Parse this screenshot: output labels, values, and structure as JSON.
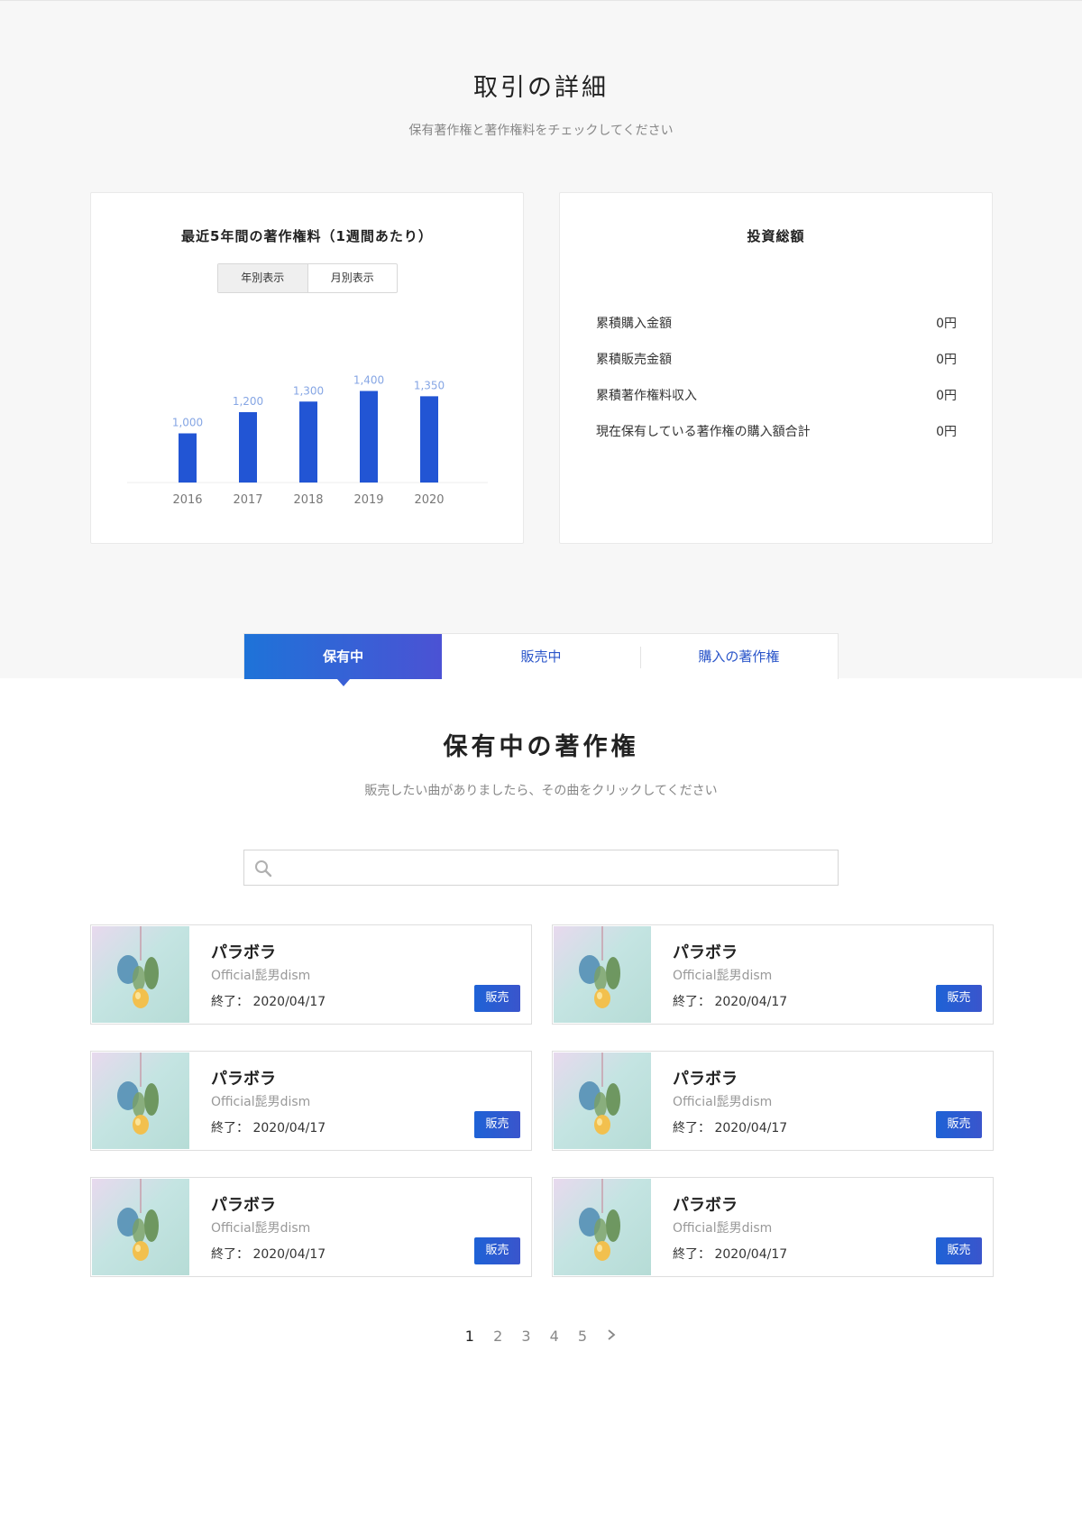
{
  "header": {
    "title": "取引の詳細",
    "subtitle": "保有著作権と著作権料をチェックしてください"
  },
  "chart_card": {
    "title": "最近5年間の著作権料（1週間あたり）",
    "toggle": {
      "yearly": "年別表示",
      "monthly": "月別表示",
      "selected": "yearly"
    }
  },
  "chart_data": {
    "type": "bar",
    "categories": [
      "2016",
      "2017",
      "2018",
      "2019",
      "2020"
    ],
    "values": [
      1000,
      1200,
      1300,
      1400,
      1350
    ],
    "value_labels": [
      "1,000",
      "1,200",
      "1,300",
      "1,400",
      "1,350"
    ],
    "title": "",
    "xlabel": "",
    "ylabel": "",
    "bar_color": "#2255d4",
    "label_color": "#86a6e4",
    "grid": false
  },
  "invest_card": {
    "title": "投資総額",
    "rows": [
      {
        "label": "累積購入金額",
        "value": "0円"
      },
      {
        "label": "累積販売金額",
        "value": "0円"
      },
      {
        "label": "累積著作権料収入",
        "value": "0円"
      },
      {
        "label": "現在保有している著作権の購入額合計",
        "value": "0円"
      }
    ]
  },
  "tabs": [
    {
      "label": "保有中",
      "active": true
    },
    {
      "label": "販売中",
      "active": false
    },
    {
      "label": "購入の著作権",
      "active": false
    }
  ],
  "owned": {
    "title": "保有中の著作権",
    "subtitle": "販売したい曲がありましたら、その曲をクリックしてください"
  },
  "search": {
    "placeholder": "",
    "value": ""
  },
  "items": [
    {
      "title": "パラボラ",
      "artist": "Official髭男dism",
      "end": "終了： 2020/04/17",
      "button": "販売"
    },
    {
      "title": "パラボラ",
      "artist": "Official髭男dism",
      "end": "終了： 2020/04/17",
      "button": "販売"
    },
    {
      "title": "パラボラ",
      "artist": "Official髭男dism",
      "end": "終了： 2020/04/17",
      "button": "販売"
    },
    {
      "title": "パラボラ",
      "artist": "Official髭男dism",
      "end": "終了： 2020/04/17",
      "button": "販売"
    },
    {
      "title": "パラボラ",
      "artist": "Official髭男dism",
      "end": "終了： 2020/04/17",
      "button": "販売"
    },
    {
      "title": "パラボラ",
      "artist": "Official髭男dism",
      "end": "終了： 2020/04/17",
      "button": "販売"
    }
  ],
  "pagination": {
    "pages": [
      "1",
      "2",
      "3",
      "4",
      "5"
    ],
    "current": "1",
    "next_icon": "chevron-right-icon"
  },
  "colors": {
    "accent": "#2a55c9",
    "tab_gradient_start": "#1e73d8",
    "tab_gradient_end": "#4b52d4"
  }
}
